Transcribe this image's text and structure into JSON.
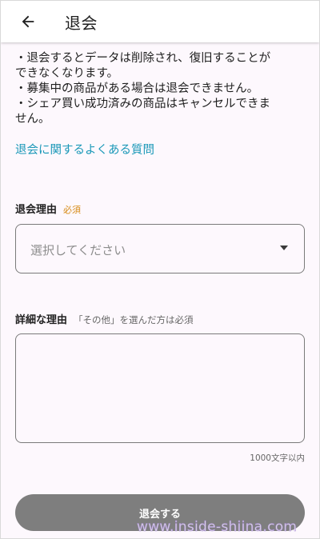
{
  "header": {
    "title": "退会",
    "back_icon": "arrow-left-icon"
  },
  "notes": [
    "・退会するとデータは削除され、復旧することが",
    "できなくなります。",
    "・募集中の商品がある場合は退会できません。",
    "・シェア買い成功済みの商品はキャンセルできま",
    "せん。"
  ],
  "faq_link": "退会に関するよくある質問",
  "reason": {
    "label": "退会理由",
    "required_badge": "必須",
    "placeholder": "選択してください",
    "arrow_icon": "dropdown-triangle-icon"
  },
  "detail": {
    "label": "詳細な理由",
    "hint": "「その他」を選んだ方は必須",
    "value": "",
    "char_limit": "1000文字以内"
  },
  "submit_label": "退会する",
  "watermark": "www.inside-shiina.com",
  "colors": {
    "link": "#1a98b8",
    "required": "#d68a14",
    "button": "#7e7e7e",
    "background": "#fdf8fd"
  }
}
